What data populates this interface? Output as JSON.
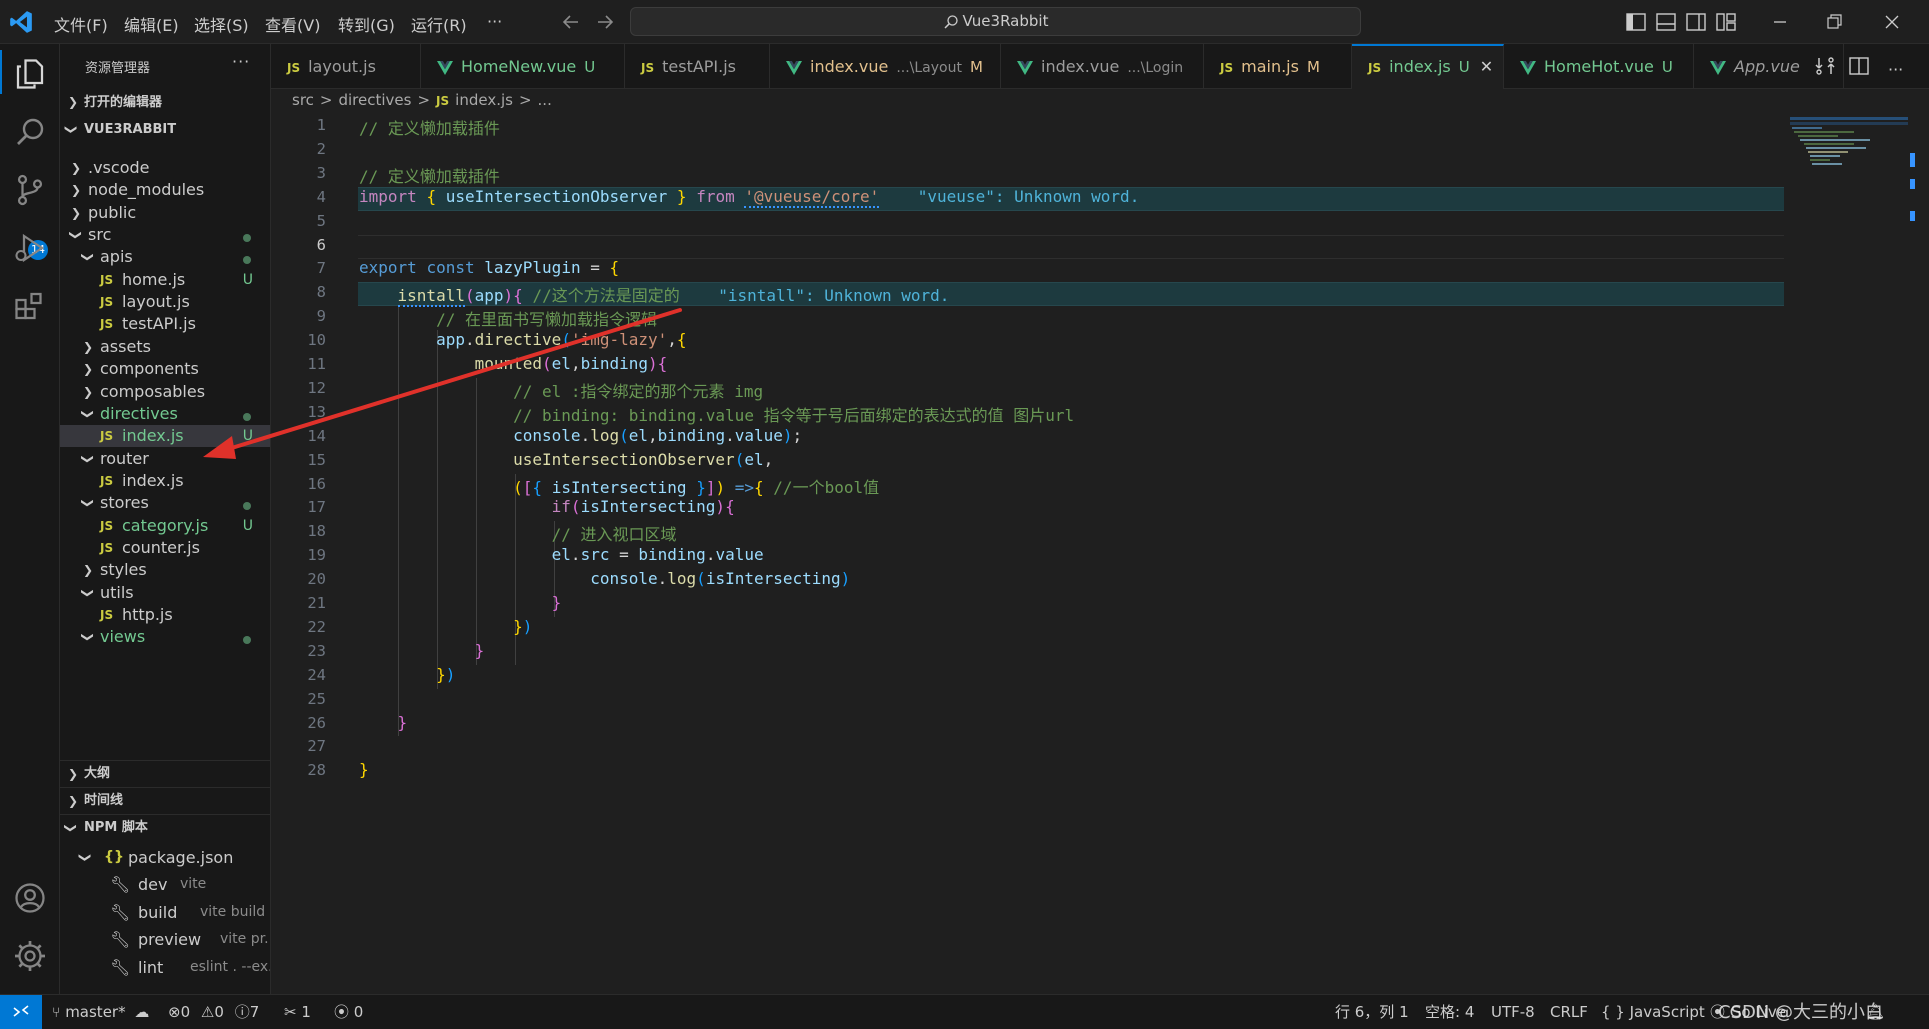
{
  "titlebar": {
    "menus": [
      "文件(F)",
      "编辑(E)",
      "选择(S)",
      "查看(V)",
      "转到(G)",
      "运行(R)",
      "···"
    ],
    "search": "Vue3Rabbit",
    "icons": [
      "vscode-logo-icon",
      "arrow-left-icon",
      "arrow-right-icon",
      "search-icon",
      "toggle-primary-sidebar-icon",
      "toggle-panel-icon",
      "toggle-secondary-sidebar-icon",
      "customize-layout-icon",
      "minimize-icon",
      "restore-icon",
      "close-icon"
    ]
  },
  "activity_bar": {
    "items": [
      "explorer-icon",
      "search-icon",
      "source-control-icon",
      "run-debug-icon",
      "extensions-icon",
      "accounts-icon",
      "manage-gear-icon"
    ],
    "scm_badge": "14"
  },
  "sidebar": {
    "title": "资源管理器",
    "more": "···",
    "open_editors": "打开的编辑器",
    "project": "VUE3RABBIT",
    "tree": [
      {
        "label": ".vscode",
        "kind": "folder",
        "open": false,
        "depth": 1
      },
      {
        "label": "node_modules",
        "kind": "folder",
        "open": false,
        "depth": 1
      },
      {
        "label": "public",
        "kind": "folder",
        "open": false,
        "depth": 1
      },
      {
        "label": "src",
        "kind": "folder",
        "open": true,
        "depth": 1,
        "dot": true
      },
      {
        "label": "apis",
        "kind": "folder",
        "open": true,
        "depth": 2,
        "dot": true
      },
      {
        "label": "home.js",
        "kind": "js",
        "depth": 3,
        "status": "U"
      },
      {
        "label": "layout.js",
        "kind": "js",
        "depth": 3
      },
      {
        "label": "testAPI.js",
        "kind": "js",
        "depth": 3
      },
      {
        "label": "assets",
        "kind": "folder",
        "open": false,
        "depth": 2
      },
      {
        "label": "components",
        "kind": "folder",
        "open": false,
        "depth": 2
      },
      {
        "label": "composables",
        "kind": "folder",
        "open": false,
        "depth": 2
      },
      {
        "label": "directives",
        "kind": "folder",
        "open": true,
        "depth": 2,
        "dot": true,
        "green": true
      },
      {
        "label": "index.js",
        "kind": "js",
        "depth": 3,
        "status": "U",
        "selected": true,
        "green": true
      },
      {
        "label": "router",
        "kind": "folder",
        "open": true,
        "depth": 2
      },
      {
        "label": "index.js",
        "kind": "js",
        "depth": 3
      },
      {
        "label": "stores",
        "kind": "folder",
        "open": true,
        "depth": 2,
        "dot": true
      },
      {
        "label": "category.js",
        "kind": "js",
        "depth": 3,
        "status": "U",
        "green": true
      },
      {
        "label": "counter.js",
        "kind": "js",
        "depth": 3
      },
      {
        "label": "styles",
        "kind": "folder",
        "open": false,
        "depth": 2
      },
      {
        "label": "utils",
        "kind": "folder",
        "open": true,
        "depth": 2
      },
      {
        "label": "http.js",
        "kind": "js",
        "depth": 3
      },
      {
        "label": "views",
        "kind": "folder",
        "open": true,
        "depth": 2,
        "dot": true,
        "green": true
      }
    ],
    "outline": "大纲",
    "timeline": "时间线",
    "npm": "NPM 脚本",
    "package": "package.json",
    "scripts": [
      {
        "name": "dev",
        "cmd": "vite"
      },
      {
        "name": "build",
        "cmd": "vite build"
      },
      {
        "name": "preview",
        "cmd": "vite pr..."
      },
      {
        "name": "lint",
        "cmd": "eslint . --ex..."
      }
    ]
  },
  "tabs": [
    {
      "type": "js",
      "label": "layout.js"
    },
    {
      "type": "vue",
      "label": "HomeNew.vue",
      "mark": "U",
      "color": "#73c991"
    },
    {
      "type": "js",
      "label": "testAPI.js"
    },
    {
      "type": "vue",
      "label": "index.vue",
      "desc": "...\\Layout",
      "mark": "M",
      "color": "#e2c08d"
    },
    {
      "type": "vue",
      "label": "index.vue",
      "desc": "...\\Login"
    },
    {
      "type": "js",
      "label": "main.js",
      "mark": "M",
      "color": "#e2c08d"
    },
    {
      "type": "js",
      "label": "index.js",
      "mark": "U",
      "color": "#73c991",
      "active": true,
      "close": "✕"
    },
    {
      "type": "vue",
      "label": "HomeHot.vue",
      "mark": "U",
      "color": "#73c991"
    },
    {
      "type": "vue",
      "label": "App.vue",
      "italic": true
    }
  ],
  "breadcrumb": [
    "src",
    ">",
    "directives",
    ">",
    "JS",
    "index.js",
    ">",
    "..."
  ],
  "editor": {
    "current_line": 6,
    "lines": [
      [
        [
          "cm",
          "// 定义懒加载插件"
        ]
      ],
      [],
      [
        [
          "cm",
          "// 定义懒加载插件"
        ]
      ],
      [
        [
          "kc",
          "import"
        ],
        [
          "pl",
          " "
        ],
        [
          "b1",
          "{"
        ],
        [
          "pl",
          " "
        ],
        [
          "vr",
          "useIntersectionObserver"
        ],
        [
          "pl",
          " "
        ],
        [
          "b1",
          "}"
        ],
        [
          "pl",
          " "
        ],
        [
          "kc",
          "from"
        ],
        [
          "pl",
          " "
        ],
        [
          "st",
          "'@vueuse/core'"
        ],
        [
          "pl",
          "    "
        ],
        [
          "err",
          "\"vueuse\": Unknown word."
        ]
      ],
      [],
      [],
      [
        [
          "k",
          "export"
        ],
        [
          "pl",
          " "
        ],
        [
          "k",
          "const"
        ],
        [
          "pl",
          " "
        ],
        [
          "vr",
          "lazyPlugin"
        ],
        [
          "pl",
          " = "
        ],
        [
          "b1",
          "{"
        ]
      ],
      [
        [
          "pl",
          "    "
        ],
        [
          "fn",
          "isntall"
        ],
        [
          "b2",
          "("
        ],
        [
          "vr",
          "app"
        ],
        [
          "b2",
          ")"
        ],
        [
          "b2",
          "{"
        ],
        [
          "pl",
          " "
        ],
        [
          "cm",
          "//这个方法是固定的"
        ],
        [
          "pl",
          "    "
        ],
        [
          "err",
          "\"isntall\": Unknown word."
        ]
      ],
      [
        [
          "pl",
          "        "
        ],
        [
          "cm",
          "// 在里面书写懒加载指令逻辑"
        ]
      ],
      [
        [
          "pl",
          "        "
        ],
        [
          "vr",
          "app"
        ],
        [
          "pl",
          "."
        ],
        [
          "fn",
          "directive"
        ],
        [
          "b3",
          "("
        ],
        [
          "st",
          "'img-lazy'"
        ],
        [
          "pl",
          ","
        ],
        [
          "b1",
          "{"
        ]
      ],
      [
        [
          "pl",
          "            "
        ],
        [
          "fn",
          "mounted"
        ],
        [
          "b2",
          "("
        ],
        [
          "vr",
          "el"
        ],
        [
          "pl",
          ","
        ],
        [
          "vr",
          "binding"
        ],
        [
          "b2",
          ")"
        ],
        [
          "b2",
          "{"
        ]
      ],
      [
        [
          "pl",
          "                "
        ],
        [
          "cm",
          "// el :指令绑定的那个元素 img"
        ]
      ],
      [
        [
          "pl",
          "                "
        ],
        [
          "cm",
          "// binding: binding.value 指令等于号后面绑定的表达式的值 图片url"
        ]
      ],
      [
        [
          "pl",
          "                "
        ],
        [
          "vr",
          "console"
        ],
        [
          "pl",
          "."
        ],
        [
          "fn",
          "log"
        ],
        [
          "b3",
          "("
        ],
        [
          "vr",
          "el"
        ],
        [
          "pl",
          ","
        ],
        [
          "vr",
          "binding"
        ],
        [
          "pl",
          "."
        ],
        [
          "vr",
          "value"
        ],
        [
          "b3",
          ")"
        ],
        [
          "pl",
          ";"
        ]
      ],
      [
        [
          "pl",
          "                "
        ],
        [
          "fn",
          "useIntersectionObserver"
        ],
        [
          "b3",
          "("
        ],
        [
          "vr",
          "el"
        ],
        [
          "pl",
          ","
        ]
      ],
      [
        [
          "pl",
          "                "
        ],
        [
          "b1",
          "("
        ],
        [
          "b2",
          "["
        ],
        [
          "b3",
          "{"
        ],
        [
          "pl",
          " "
        ],
        [
          "vr",
          "isIntersecting"
        ],
        [
          "pl",
          " "
        ],
        [
          "b3",
          "}"
        ],
        [
          "b2",
          "]"
        ],
        [
          "b1",
          ")"
        ],
        [
          "pl",
          " "
        ],
        [
          "k",
          "=>"
        ],
        [
          "b1",
          "{"
        ],
        [
          "pl",
          " "
        ],
        [
          "cm",
          "//一个bool值"
        ]
      ],
      [
        [
          "pl",
          "                    "
        ],
        [
          "kc",
          "if"
        ],
        [
          "b2",
          "("
        ],
        [
          "vr",
          "isIntersecting"
        ],
        [
          "b2",
          ")"
        ],
        [
          "b2",
          "{"
        ]
      ],
      [
        [
          "pl",
          "                    "
        ],
        [
          "cm",
          "// 进入视口区域"
        ]
      ],
      [
        [
          "pl",
          "                    "
        ],
        [
          "vr",
          "el"
        ],
        [
          "pl",
          "."
        ],
        [
          "vr",
          "src"
        ],
        [
          "pl",
          " = "
        ],
        [
          "vr",
          "binding"
        ],
        [
          "pl",
          "."
        ],
        [
          "vr",
          "value"
        ]
      ],
      [
        [
          "pl",
          "                        "
        ],
        [
          "vr",
          "console"
        ],
        [
          "pl",
          "."
        ],
        [
          "fn",
          "log"
        ],
        [
          "b3",
          "("
        ],
        [
          "vr",
          "isIntersecting"
        ],
        [
          "b3",
          ")"
        ]
      ],
      [
        [
          "pl",
          "                    "
        ],
        [
          "b2",
          "}"
        ]
      ],
      [
        [
          "pl",
          "                "
        ],
        [
          "b1",
          "}"
        ],
        [
          "b3",
          ")"
        ]
      ],
      [
        [
          "pl",
          "            "
        ],
        [
          "b2",
          "}"
        ]
      ],
      [
        [
          "pl",
          "        "
        ],
        [
          "b1",
          "}"
        ],
        [
          "b3",
          ")"
        ]
      ],
      [],
      [
        [
          "pl",
          "    "
        ],
        [
          "b2",
          "}"
        ]
      ],
      [],
      [
        [
          "b1",
          "}"
        ]
      ]
    ]
  },
  "statusbar": {
    "branch": "master*",
    "errors": "0",
    "warnings": "0",
    "infos": "7",
    "ports": "1",
    "broadcast": "0",
    "position": "行 6，列 1",
    "spaces": "空格: 4",
    "encoding": "UTF-8",
    "eol": "CRLF",
    "language": "{ } JavaScript",
    "golive": "Go Live",
    "watermark": "CSDN @大三的小白"
  },
  "colors": {
    "accent": "#0078d4",
    "untracked": "#73c991",
    "modified": "#e2c08d",
    "annotation_arrow": "#e0312a"
  }
}
